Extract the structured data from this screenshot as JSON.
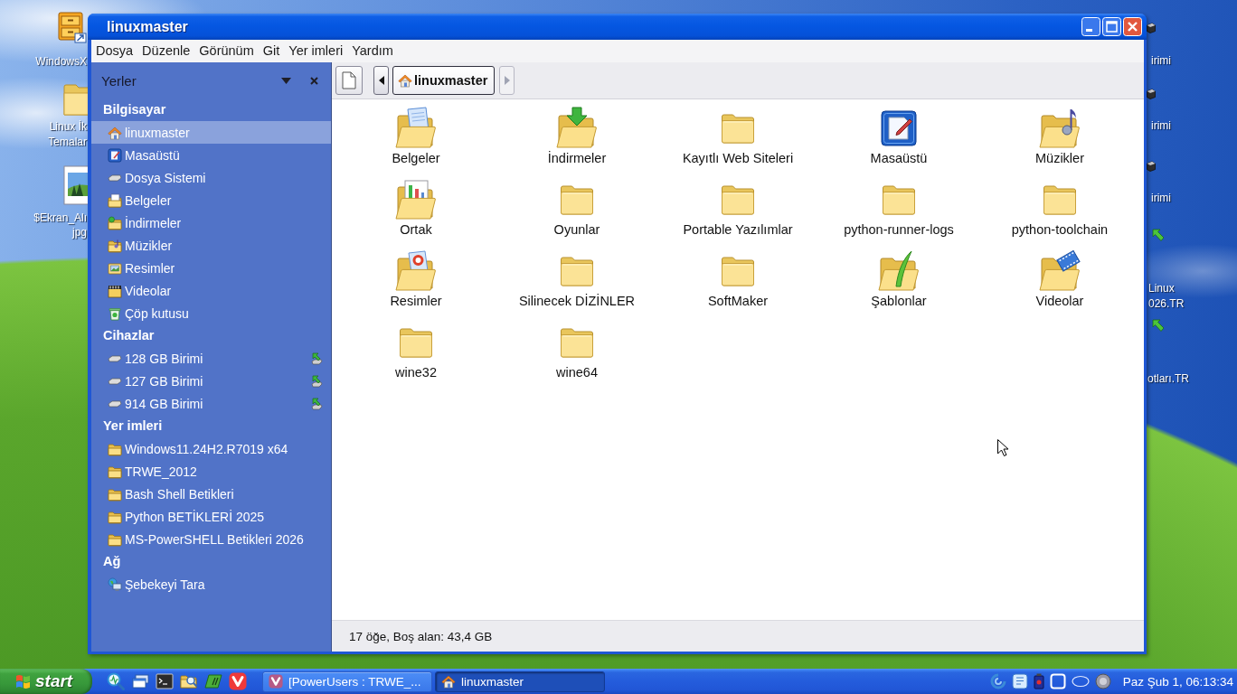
{
  "desktop": {
    "left_icons": [
      {
        "kind": "cabinet",
        "lines": [
          "WindowsX"
        ]
      },
      {
        "kind": "folder",
        "lines": [
          "Linux İk",
          "Temalar"
        ]
      },
      {
        "kind": "image",
        "lines": [
          "$Ekran_Alı",
          "jpg"
        ]
      }
    ],
    "right_icons": [
      {
        "kind": "drive",
        "lines": [
          "irimi"
        ]
      },
      {
        "kind": "drive",
        "lines": [
          "irimi"
        ]
      },
      {
        "kind": "drive",
        "lines": [
          "irimi"
        ]
      },
      {
        "kind": "shortcut",
        "lines": [
          "Linux",
          "026.TR"
        ]
      },
      {
        "kind": "shortcut",
        "lines": [
          "otları.TR"
        ]
      }
    ]
  },
  "window": {
    "title": "linuxmaster"
  },
  "menu": [
    "Dosya",
    "Düzenle",
    "Görünüm",
    "Git",
    "Yer imleri",
    "Yardım"
  ],
  "sidebar": {
    "title": "Yerler",
    "sections": [
      {
        "title": "Bilgisayar",
        "items": [
          {
            "label": "linuxmaster",
            "kind": "home",
            "selected": true
          },
          {
            "label": "Masaüstü",
            "kind": "desktop",
            "selected": false
          },
          {
            "label": "Dosya Sistemi",
            "kind": "drive",
            "selected": false
          },
          {
            "label": "Belgeler",
            "kind": "documents",
            "selected": false
          },
          {
            "label": "İndirmeler",
            "kind": "downloads",
            "selected": false
          },
          {
            "label": "Müzikler",
            "kind": "music",
            "selected": false
          },
          {
            "label": "Resimler",
            "kind": "pictures",
            "selected": false
          },
          {
            "label": "Videolar",
            "kind": "videos",
            "selected": false
          },
          {
            "label": "Çöp kutusu",
            "kind": "trash",
            "selected": false
          }
        ]
      },
      {
        "title": "Cihazlar",
        "items": [
          {
            "label": "128 GB Birimi",
            "kind": "drive",
            "selected": false,
            "mounted": true
          },
          {
            "label": "127 GB Birimi",
            "kind": "drive",
            "selected": false,
            "mounted": true
          },
          {
            "label": "914 GB Birimi",
            "kind": "drive",
            "selected": false,
            "mounted": true
          }
        ]
      },
      {
        "title": "Yer imleri",
        "items": [
          {
            "label": "Windows11.24H2.R7019 x64",
            "kind": "folder",
            "selected": false
          },
          {
            "label": "TRWE_2012",
            "kind": "folder",
            "selected": false
          },
          {
            "label": "Bash Shell Betikleri",
            "kind": "folder",
            "selected": false
          },
          {
            "label": "Python BETİKLERİ 2025",
            "kind": "folder",
            "selected": false
          },
          {
            "label": "MS-PowerSHELL Betikleri 2026",
            "kind": "folder",
            "selected": false
          }
        ]
      },
      {
        "title": "Ağ",
        "items": [
          {
            "label": "Şebekeyi Tara",
            "kind": "network",
            "selected": false
          }
        ]
      }
    ]
  },
  "toolbar": {
    "back": {
      "disabled": false
    },
    "path": [
      {
        "label": "linuxmaster",
        "selected": true
      }
    ],
    "forward": {
      "disabled": true
    }
  },
  "files": [
    {
      "name": "Belgeler",
      "kind": "documents"
    },
    {
      "name": "İndirmeler",
      "kind": "downloads"
    },
    {
      "name": "Kayıtlı Web Siteleri",
      "kind": "folder"
    },
    {
      "name": "Masaüstü",
      "kind": "desktop"
    },
    {
      "name": "Müzikler",
      "kind": "music"
    },
    {
      "name": "Ortak",
      "kind": "shared"
    },
    {
      "name": "Oyunlar",
      "kind": "folder"
    },
    {
      "name": "Portable Yazılımlar",
      "kind": "folder"
    },
    {
      "name": "python-runner-logs",
      "kind": "folder"
    },
    {
      "name": "python-toolchain",
      "kind": "folder"
    },
    {
      "name": "Resimler",
      "kind": "pictures"
    },
    {
      "name": "Silinecek DİZİNLER",
      "kind": "folder"
    },
    {
      "name": "SoftMaker",
      "kind": "folder"
    },
    {
      "name": "Şablonlar",
      "kind": "templates"
    },
    {
      "name": "Videolar",
      "kind": "videos"
    },
    {
      "name": "wine32",
      "kind": "folder"
    },
    {
      "name": "wine64",
      "kind": "folder"
    }
  ],
  "status_bar": "17 öğe, Boş alan: 43,4 GB",
  "taskbar": {
    "start": "start",
    "tasks": [
      {
        "label": "[PowerUsers : TRWE_...",
        "kind": "browser",
        "selected": false
      },
      {
        "label": "linuxmaster",
        "kind": "home",
        "selected": true
      }
    ],
    "clock": "Paz Şub 1, 06:13:34"
  }
}
